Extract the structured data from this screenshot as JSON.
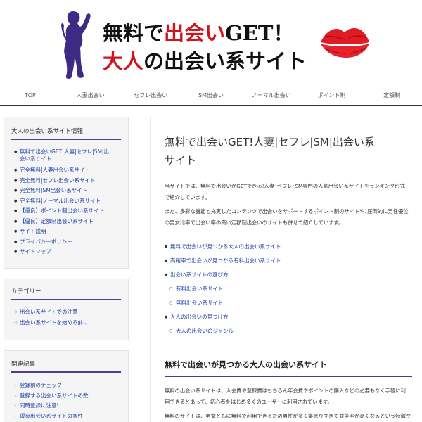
{
  "header": {
    "line1_a": "無料で",
    "line1_b": "出会い",
    "line1_c": "GET！",
    "line2_a": "大人",
    "line2_b": "の出会い系サイト"
  },
  "nav": [
    "TOP",
    "人妻出会い",
    "セフレ出会い",
    "SM出会い",
    "ノーマル出会い",
    "ポイント制",
    "定額制"
  ],
  "sidebar": {
    "info_title": "大人の出会い系サイト情報",
    "info_items": [
      "無料で出会いGET!人妻|セフレ|SM|出",
      "会い系サイト",
      "完全無料|人妻出会い系サイト",
      "完全無料|セフレ出会い系サイト",
      "完全無料|SM出会い系サイト",
      "完全無料|ノーマル出会い系サイト",
      "【優良】ポイント制出会い系サイト",
      "【優良】定額制出会い系サイト",
      "サイト説明",
      "プライバシーポリシー",
      "サイトマップ"
    ],
    "category_title": "カテゴリー",
    "category_items": [
      "出会い系サイトでの注意",
      "出会い系サイトを始める前に"
    ],
    "related_title": "関連記事",
    "related_items": [
      "登録前のチェック",
      "登録する出会い系サイトの数",
      "同時登録に注意!",
      "優良出会い系サイトの条件"
    ]
  },
  "main": {
    "title_line1": "無料で出会いGET!人妻|セフレ|SM|出会い系",
    "title_line2": "サイト",
    "intro1_line1": "当サイトでは、無料で出会いがGETできる!人妻･セフレ･SM専門の人気出会い系サイトをランキング形式",
    "intro1_line2": "で紹介しています。",
    "intro2_line1": "また、多彩な機能と充実したコンテンツで出会いをサポートするポイント制のサイトや､圧倒的に男性優位",
    "intro2_line2": "の男女比率で出会い率の高い定額制出会いのサイトも併せて紹介しています。",
    "toc": [
      {
        "level": 1,
        "label": "無料で出会いが見つかる大人の出会い系サイト"
      },
      {
        "level": 1,
        "label": "高確率で出会いが見つかる有料出会い系サイト"
      },
      {
        "level": 1,
        "label": "出会い系サイトの選び方"
      },
      {
        "level": 2,
        "label": "有料出会い系サイト"
      },
      {
        "level": 2,
        "label": "無料出会い系サイト"
      },
      {
        "level": 1,
        "label": "大人の出会いの見つけ方"
      },
      {
        "level": 2,
        "label": "大人の出会いのジャンル"
      }
    ],
    "section_heading": "無料で出会いが見つかる大人の出会い系サイト",
    "body1_line1": "無料の出会い系サイトは、入会費や登録費はもちろん年会費やポイントの購入などの必要もなく手軽に利",
    "body1_line2": "用できるとあって、初心者をはじめ多くのユーザーに利用されています。",
    "body2_line1": "無料のサイトは、男女ともに無料で利用できるため男性が多く集まりすぎて競争率が高くなるという特徴が"
  },
  "colors": {
    "accent": "#4b3d8f",
    "red": "#d1141b",
    "link": "#1a3ea8"
  }
}
